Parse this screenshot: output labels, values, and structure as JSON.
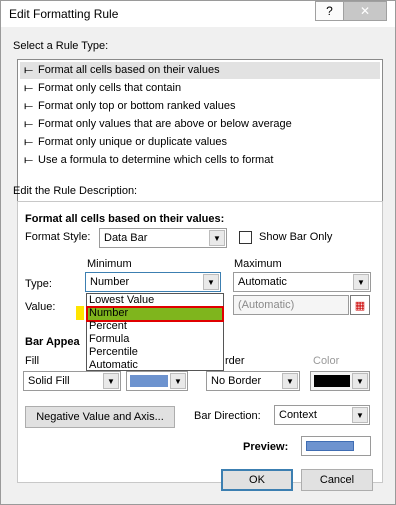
{
  "window": {
    "title": "Edit Formatting Rule",
    "help_label": "?",
    "close_label": "✕"
  },
  "rule_type": {
    "heading": "Select a Rule Type:",
    "items": [
      {
        "label": "Format all cells based on their values",
        "selected": true
      },
      {
        "label": "Format only cells that contain"
      },
      {
        "label": "Format only top or bottom ranked values"
      },
      {
        "label": "Format only values that are above or below average"
      },
      {
        "label": "Format only unique or duplicate values"
      },
      {
        "label": "Use a formula to determine which cells to format"
      }
    ]
  },
  "description": {
    "heading": "Edit the Rule Description:",
    "panel_heading": "Format all cells based on their values:",
    "format_style_label": "Format Style:",
    "format_style_value": "Data Bar",
    "show_bar_only_label": "Show Bar Only",
    "minimum_label": "Minimum",
    "maximum_label": "Maximum",
    "type_label": "Type:",
    "value_label": "Value:",
    "min_type_value": "Number",
    "max_type_value": "Automatic",
    "max_value_placeholder": "(Automatic)",
    "type_options": [
      "Lowest Value",
      "Number",
      "Percent",
      "Formula",
      "Percentile",
      "Automatic"
    ],
    "highlighted_option": "Number"
  },
  "bar_appearance": {
    "heading": "Bar Appea",
    "fill_label": "Fill",
    "border_label": "rder",
    "color_label": "Color",
    "fill_value": "Solid Fill",
    "border_value": "No Border",
    "fill_color": "#6d93cf",
    "border_color": "#000000",
    "negative_button": "Negative Value and Axis...",
    "direction_label": "Bar Direction:",
    "direction_value": "Context",
    "preview_label": "Preview:"
  },
  "footer": {
    "ok": "OK",
    "cancel": "Cancel"
  }
}
